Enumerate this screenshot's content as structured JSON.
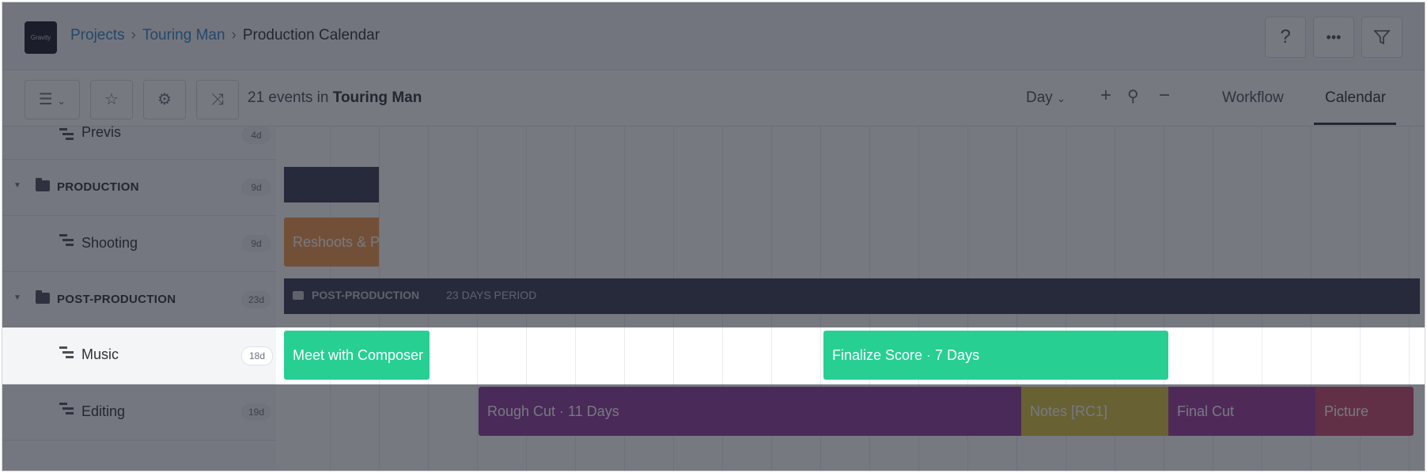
{
  "header": {
    "logo_text": "Gravity",
    "breadcrumb": [
      "Projects",
      "Touring Man",
      "Production Calendar"
    ]
  },
  "header_icons": [
    "help-icon",
    "more-icon",
    "filter-icon"
  ],
  "toolbar": {
    "event_count_prefix": "21 events in",
    "project_name": "Touring Man",
    "view_mode": "Day",
    "tabs": [
      "Workflow",
      "Calendar"
    ],
    "active_tab": "Calendar"
  },
  "rows": [
    {
      "label": "Previs",
      "count": "4d"
    },
    {
      "label": "PRODUCTION",
      "count": "9d"
    },
    {
      "label": "Shooting",
      "count": "9d"
    },
    {
      "label": "POST-PRODUCTION",
      "count": "23d"
    },
    {
      "label": "Music",
      "count": "18d"
    },
    {
      "label": "Editing",
      "count": "19d"
    }
  ],
  "group_bar": {
    "title": "POST-PRODUCTION",
    "period": "23 DAYS PERIOD"
  },
  "events": {
    "reshoots": "Reshoots & Pick",
    "meet_composer": "Meet with Composer",
    "finalize_score": "Finalize Score · 7 Days",
    "rough_cut": "Rough Cut · 11 Days",
    "notes": "Notes [RC1]",
    "final_cut": "Final Cut",
    "picture": "Picture"
  },
  "colors": {
    "accent": "#2e84c6",
    "music": "#27cf93",
    "rough_cut": "#8c3a98",
    "notes": "#dac23e",
    "final_cut": "#9b3a9b",
    "picture": "#c84a6e",
    "shooting": "#f39a4a",
    "group": "#363b4e"
  }
}
